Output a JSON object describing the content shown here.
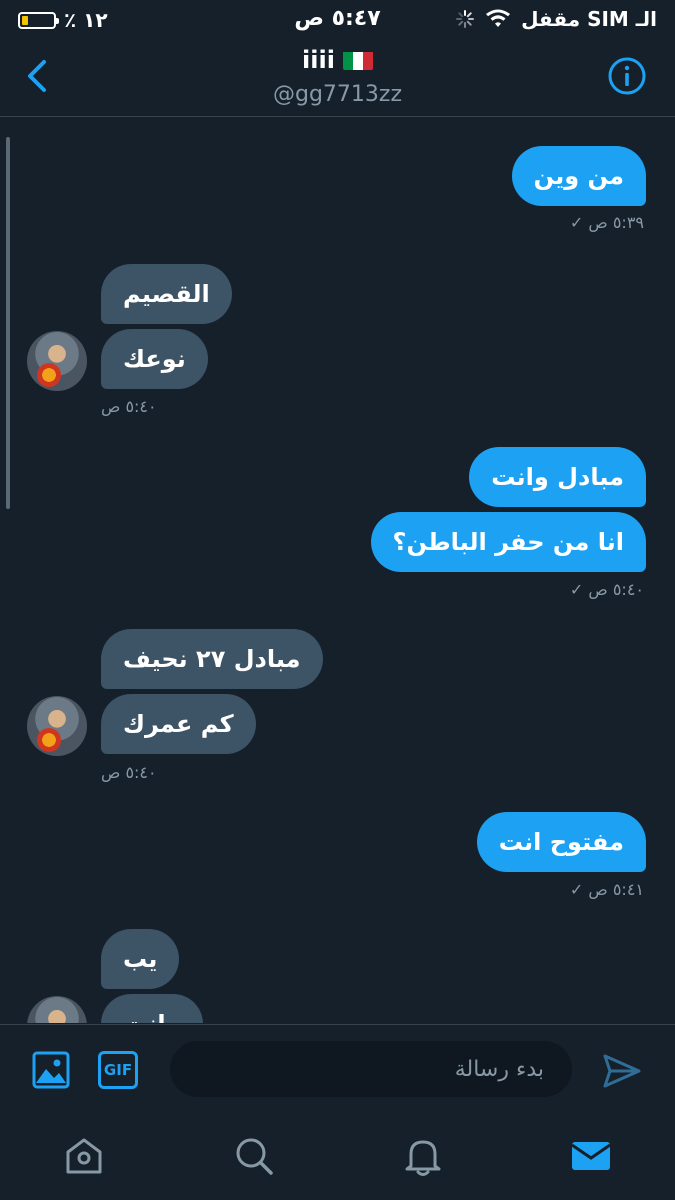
{
  "status_bar": {
    "battery_percent": "١٢ ٪",
    "battery_level": 0.12,
    "time": "٥:٤٧ ص",
    "carrier": "الـ SIM مقفل"
  },
  "header": {
    "title": "iiii",
    "handle": "@gg7713zz"
  },
  "messages": [
    {
      "direction": "out",
      "text": "من وين",
      "time": "٥:٣٩ ص"
    },
    {
      "direction": "in",
      "text": "القصيم"
    },
    {
      "direction": "in",
      "text": "نوعك",
      "time": "٥:٤٠ ص"
    },
    {
      "direction": "out",
      "text": "مبادل وانت"
    },
    {
      "direction": "out",
      "text": "انا من حفر الباطن؟",
      "time": "٥:٤٠ ص"
    },
    {
      "direction": "in",
      "text": "مبادل ٢٧ نحيف"
    },
    {
      "direction": "in",
      "text": "كم عمرك",
      "time": "٥:٤٠ ص"
    },
    {
      "direction": "out",
      "text": "مفتوح انت",
      "time": "٥:٤١ ص"
    },
    {
      "direction": "in",
      "text": "يب"
    },
    {
      "direction": "in",
      "text": "وانت"
    }
  ],
  "composer": {
    "placeholder": "بدء رسالة",
    "gif_label": "GIF"
  },
  "colors": {
    "background": "#15202b",
    "accent": "#1da1f2",
    "incoming_bubble": "#3d5466",
    "muted_text": "#8899a6"
  },
  "icons": {
    "back": "chevron-left-icon",
    "info": "info-icon",
    "image": "image-icon",
    "send": "send-icon",
    "home": "home-icon",
    "search": "search-icon",
    "notifications": "bell-icon",
    "messages": "mail-icon"
  }
}
